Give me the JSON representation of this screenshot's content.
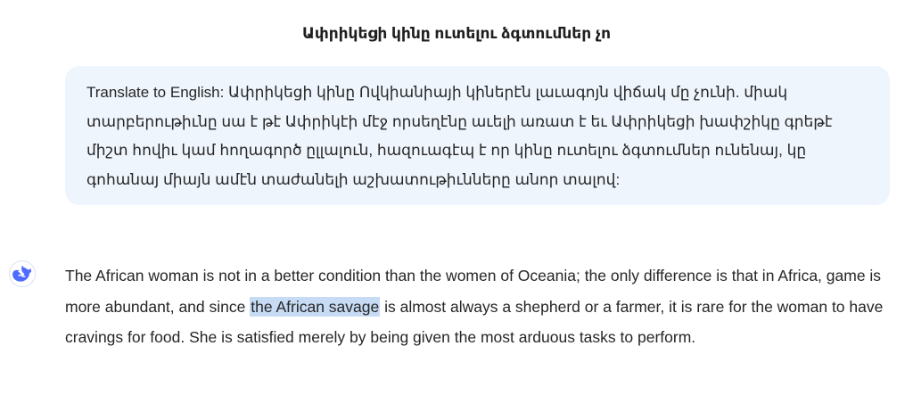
{
  "chat": {
    "title": "Ափրիկեցի կինը ուտելու ձգտումներ չո"
  },
  "user_message": {
    "text": "Translate to English: Ափրիկեցի կինը Ովկիանիայի կիներէն լաւագոյն վիճակ մը չունի. միակ տարբերութիւնը սա է թէ Ափրիկէի մէջ որսեղէնը աւելի առատ է եւ Ափրիկեցի խափշիկը գրեթէ միշտ հովիւ կամ հողագործ ըլլալուն, հազուագէպ է որ կինը ուտելու ձգտումներ ունենայ, կը գոհանայ միայն ամէն տաժանելի աշխատութիւնները անոր տալով:"
  },
  "assistant_message": {
    "avatar_icon": "whale-logo-icon",
    "text_before": "The African woman is not in a better condition than the women of Oceania; the only difference is that in Africa, game is more abundant, and since ",
    "highlighted": "the African savage",
    "text_after": " is almost always a shepherd or a farmer, it is rare for the woman to have cravings for food. She is satisfied merely by being given the most arduous tasks to perform."
  },
  "colors": {
    "bubble_bg": "#eff5fd",
    "highlight": "#c7dbf5",
    "brand": "#4d6bfe"
  }
}
